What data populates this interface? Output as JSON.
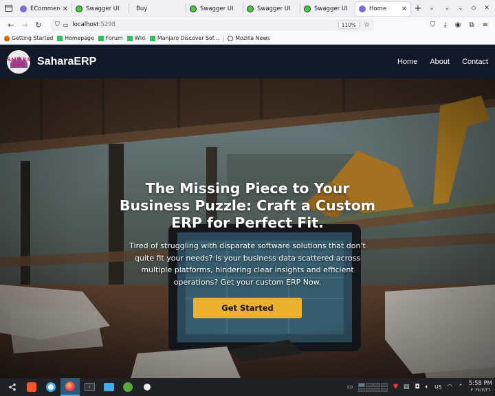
{
  "browser": {
    "tabs": [
      {
        "title": "ECommerce",
        "favicon": "ecommerce-icon",
        "active": false
      },
      {
        "title": "Swagger UI",
        "favicon": "swagger-icon",
        "active": false
      },
      {
        "title": "Buy",
        "favicon": "",
        "active": false
      },
      {
        "title": "Swagger UI",
        "favicon": "swagger-icon",
        "active": false
      },
      {
        "title": "Swagger UI",
        "favicon": "swagger-icon",
        "active": false
      },
      {
        "title": "Swagger UI",
        "favicon": "swagger-icon",
        "active": false
      },
      {
        "title": "Home",
        "favicon": "ecommerce-icon",
        "active": true
      }
    ],
    "url_host": "localhost",
    "url_port": ":5298",
    "zoom": "110%",
    "bookmarks": [
      {
        "label": "Getting Started",
        "icon": "firefox-icon"
      },
      {
        "label": "Homepage",
        "icon": "manjaro-icon"
      },
      {
        "label": "Forum",
        "icon": "manjaro-icon"
      },
      {
        "label": "Wiki",
        "icon": "manjaro-icon"
      },
      {
        "label": "Manjaro Discover Sof...",
        "icon": "manjaro-icon"
      },
      {
        "label": "Mozilla News",
        "icon": "globe-icon"
      }
    ]
  },
  "site": {
    "logo_text_top": "SAHARA",
    "logo_text_bottom": "ERP",
    "brand": "SaharaERP",
    "menu": [
      "Home",
      "About",
      "Contact"
    ]
  },
  "hero": {
    "title": "The Missing Piece to Your Business Puzzle: Craft a Custom ERP for Perfect Fit.",
    "subtitle": "Tired of struggling with disparate software solutions that don't quite fit your needs? Is your business data scattered across multiple platforms, hindering clear insights and efficient operations? Get your custom ERP Now.",
    "cta": "Get Started"
  },
  "taskbar": {
    "keyboard_layout": "us",
    "time": "5:58 PM",
    "date": "٢٠٢٤/٧/٢٦"
  },
  "colors": {
    "header_bg": "#111827",
    "cta_bg": "#ebb02d",
    "brand_accent": "#c8206a"
  }
}
